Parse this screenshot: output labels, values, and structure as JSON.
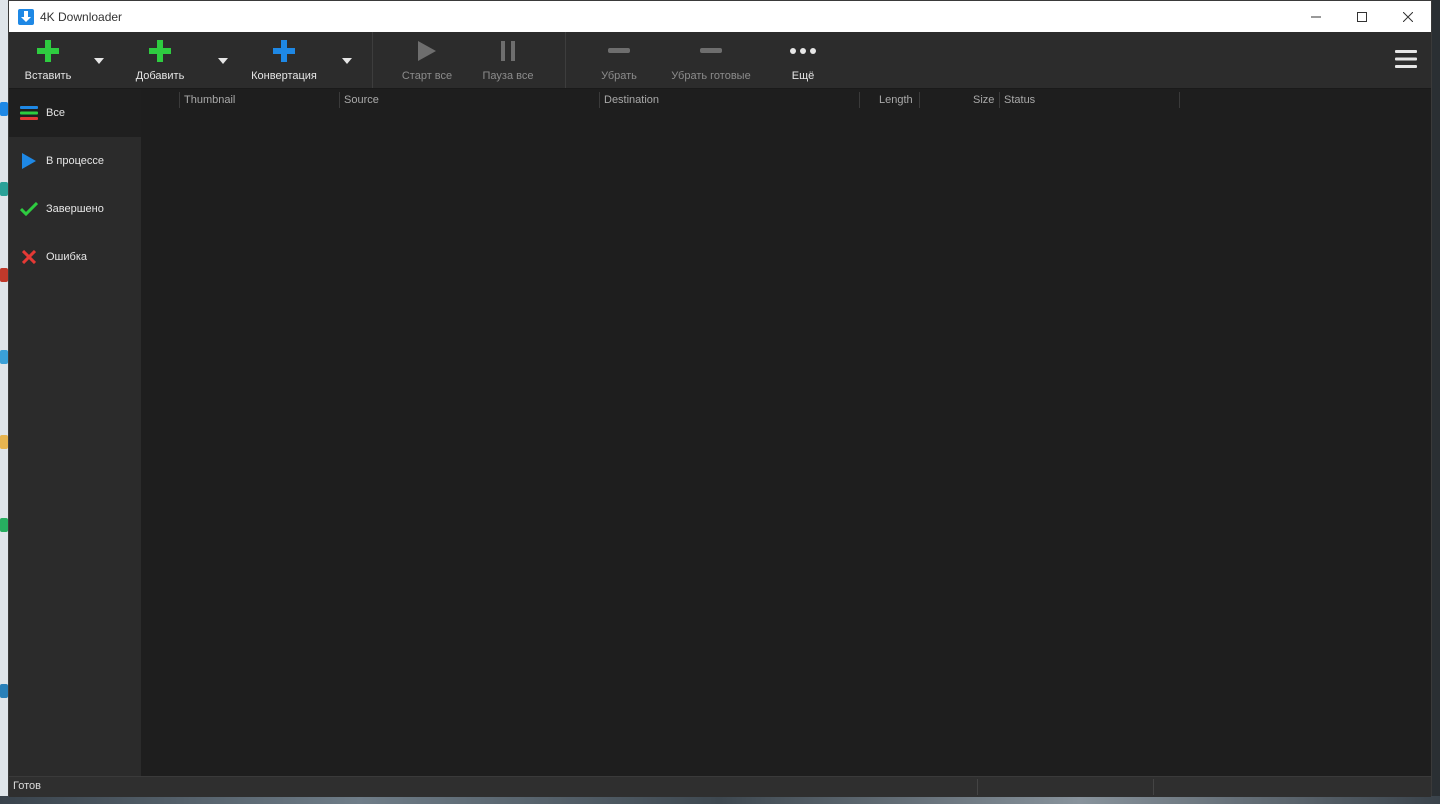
{
  "window": {
    "title": "4K Downloader"
  },
  "toolbar": {
    "paste_label": "Вставить",
    "add_label": "Добавить",
    "convert_label": "Конвертация",
    "start_all_label": "Старт все",
    "pause_all_label": "Пауза все",
    "remove_label": "Убрать",
    "remove_done_label": "Убрать готовые",
    "more_label": "Ещё"
  },
  "sidebar": {
    "items": [
      {
        "label": "Все",
        "icon": "list-icon",
        "active": true
      },
      {
        "label": "В процессе",
        "icon": "play-icon"
      },
      {
        "label": "Завершено",
        "icon": "check-icon"
      },
      {
        "label": "Ошибка",
        "icon": "cross-icon"
      }
    ]
  },
  "table": {
    "columns": [
      "Thumbnail",
      "Source",
      "Destination",
      "Length",
      "Size",
      "Status"
    ],
    "rows": []
  },
  "status": {
    "text": "Готов"
  },
  "colors": {
    "green": "#2ecc40",
    "blue": "#1e88e5",
    "red": "#e53935",
    "background": "#1e1e1e"
  }
}
